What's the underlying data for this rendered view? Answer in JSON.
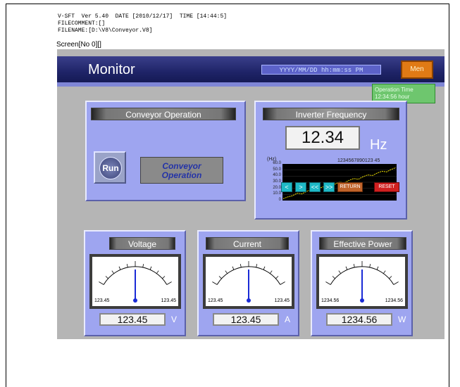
{
  "header": {
    "line1": "V-SFT  Ver 5.40  DATE [2010/12/17]  TIME [14:44:5]",
    "line2": "FILECOMMENT:[]",
    "line3": "FILENAME:[D:\\V8\\Conveyor.V8]"
  },
  "screen_label": "Screen[No 0][]",
  "titlebar": {
    "title": "Monitor",
    "datetime": "YYYY/MM/DD hh:mm:ss PM",
    "menu_label": "Men",
    "status_line1": "Operation Time",
    "status_line2": "12:34:56 hour"
  },
  "conveyor": {
    "title": "Conveyor Operation",
    "run_label": "Run",
    "operation_line1": "Conveyor",
    "operation_line2": "Operation"
  },
  "inverter": {
    "title": "Inverter Frequency",
    "value": "12.34",
    "unit": "Hz",
    "graph_unit": "(Hz)",
    "graph_label": "1234567890123 45",
    "y_ticks": [
      "60.0",
      "50.0",
      "40.0",
      "30.0",
      "20.0",
      "10.0",
      "0"
    ],
    "nav_prev": "<",
    "nav_next": ">",
    "nav_fast_prev": "<<",
    "nav_fast_next": ">>",
    "return_label": "RETURN",
    "reset_label": "RESET",
    "chart_data": {
      "type": "line",
      "y_ticks": [
        "60.0",
        "50.0",
        "40.0",
        "30.0",
        "20.0",
        "10.0",
        "0"
      ],
      "ylim": [
        0,
        60
      ],
      "series": [
        {
          "values": [
            3,
            6,
            8,
            12,
            11,
            15,
            18,
            17,
            21,
            24,
            23,
            27,
            30,
            29,
            33,
            36,
            35,
            39,
            42,
            41,
            45,
            48,
            47,
            51,
            54
          ]
        }
      ]
    }
  },
  "meters": [
    {
      "title": "Voltage",
      "min": "123.45",
      "max": "123.45",
      "value": "123.45",
      "unit": "V"
    },
    {
      "title": "Current",
      "min": "123.45",
      "max": "123.45",
      "value": "123.45",
      "unit": "A"
    },
    {
      "title": "Effective Power",
      "min": "1234.56",
      "max": "1234.56",
      "value": "1234.56",
      "unit": "W"
    }
  ],
  "colors": {
    "title_bar": "#1f2468",
    "panel": "#9ea5f0",
    "menu": "#e07a15",
    "graph_line": "#f0e000",
    "status_green": "#6ec66e"
  }
}
